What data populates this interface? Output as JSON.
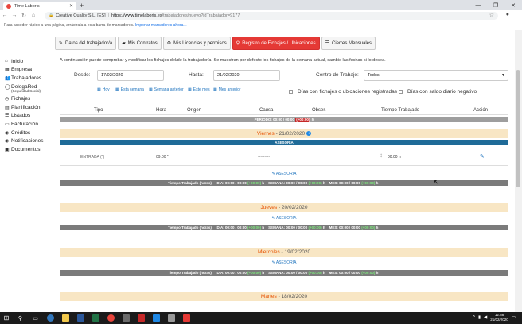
{
  "browser": {
    "tab_title": "Time Laboris",
    "omnibox_owner": "Creative Quality S.L. [ES]",
    "url_host": "https://www.timelaboris.es",
    "url_path": "/trabajadores/nuevo?idTrabajador=9177",
    "bookmarks_text": "Para acceder rápido a una página, arrástrala a esta barra de marcadores.",
    "bookmarks_link": "Importar marcadores ahora..."
  },
  "sidebar": {
    "items": [
      {
        "label": "Inicio",
        "icon": "home-icon"
      },
      {
        "label": "Empresa",
        "icon": "building-icon"
      },
      {
        "label": "Trabajadores",
        "icon": "users-icon"
      },
      {
        "label": "DelegaRed",
        "icon": "circle-icon",
        "sub": "(Seguridad Social)"
      },
      {
        "label": "Fichajes",
        "icon": "clock-icon"
      },
      {
        "label": "Planificación",
        "icon": "calendar-icon"
      },
      {
        "label": "Listados",
        "icon": "list-icon"
      },
      {
        "label": "Facturación",
        "icon": "file-icon"
      },
      {
        "label": "Créditos",
        "icon": "coin-icon"
      },
      {
        "label": "Notificaciones",
        "icon": "bell-icon"
      },
      {
        "label": "Documentos",
        "icon": "folder-icon"
      }
    ]
  },
  "tabs": [
    {
      "label": "Datos del trabajador/a",
      "icon": "edit-icon",
      "active": false
    },
    {
      "label": "Mis Contratos",
      "icon": "briefcase-icon",
      "active": false
    },
    {
      "label": "Mis Licencias y permisos",
      "icon": "gear-icon",
      "active": false
    },
    {
      "label": "Registro de Fichajes / Ubicaciones",
      "icon": "location-icon",
      "active": true
    },
    {
      "label": "Cierres Mensuales",
      "icon": "list-icon",
      "active": false
    }
  ],
  "intro": "A continuación puede comprobar y modificar los fichajes del/de la trabajador/a. Se muestran por defecto los fichajes de la semana actual, cambie las fechas si lo desea.",
  "filters": {
    "desde_label": "Desde:",
    "desde_value": "17/02/2020",
    "hasta_label": "Hasta:",
    "hasta_value": "21/02/2020",
    "centro_label": "Centro de Trabajo:",
    "centro_value": "Todos",
    "quick": [
      "Hoy",
      "Esta semana",
      "Semana anterior",
      "Este mes",
      "Mes anterior"
    ],
    "chk_ubicaciones": "Días con fichajes o ubicaciones registradas",
    "chk_negativo": "Días con saldo diario negativo"
  },
  "table": {
    "headers": [
      "Tipo",
      "Hora",
      "Origen",
      "Causa",
      "Obser.",
      "Tiempo Trabajado",
      "Acción"
    ],
    "period_label": "PERIODO:",
    "period_value": "00:00 / 00:00",
    "period_diff": "(+00:00)",
    "period_unit": "h"
  },
  "days": [
    {
      "name": "Viernes",
      "date": " - 21/02/2020",
      "company": "ASESORIA",
      "entry_tipo": "ENTRADA (*)",
      "entry_hora": "09:00 *",
      "entry_causa": "---------",
      "entry_tiempo": "00:00 h",
      "link": "ASESORIA",
      "dia": "DIA: 00:00 / 00:00",
      "semana": "SEMANA: 00:00 / 00:00",
      "mes": "MES: 00:00 / 00:00"
    },
    {
      "name": "Jueves",
      "date": " - 20/02/2020",
      "link": "ASESORIA",
      "dia": "DIA: 00:00 / 00:00",
      "semana": "SEMANA: 00:00 / 00:00",
      "mes": "MES: 00:00 / 00:00"
    },
    {
      "name": "Miercoles",
      "date": " - 19/02/2020",
      "link": "ASESORIA",
      "dia": "DIA: 00:00 / 00:00",
      "semana": "SEMANA: 00:00 / 00:00",
      "mes": "MES: 00:00 / 00:00"
    },
    {
      "name": "Martes",
      "date": " - 18/02/2020"
    }
  ],
  "summary": {
    "label": "Tiempo Trabajado (horas):",
    "diff": "(+00:00)",
    "unit": "h"
  },
  "taskbar": {
    "time": "12:58",
    "date": "21/02/2020"
  },
  "colors": {
    "active_tab": "#e53935",
    "day_header": "#f8e6c4",
    "company_bar": "#1f6b98",
    "summary_bar": "#7b7b7b"
  }
}
